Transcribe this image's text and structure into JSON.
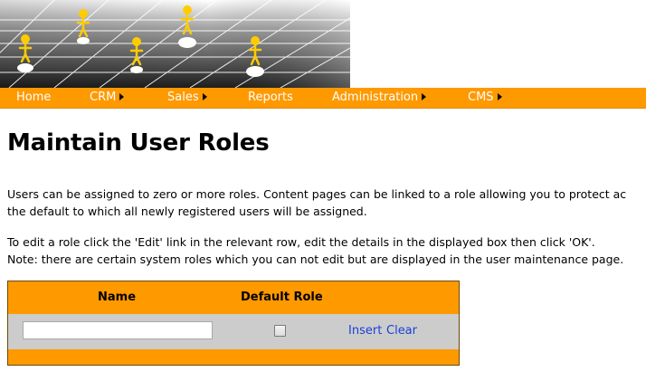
{
  "nav": {
    "items": [
      {
        "label": "Home",
        "has_submenu": false
      },
      {
        "label": "CRM",
        "has_submenu": true
      },
      {
        "label": "Sales",
        "has_submenu": true
      },
      {
        "label": "Reports",
        "has_submenu": false
      },
      {
        "label": "Administration",
        "has_submenu": true
      },
      {
        "label": "CMS",
        "has_submenu": true
      }
    ]
  },
  "page": {
    "title": "Maintain User Roles",
    "intro_line1": "Users can be assigned to zero or more roles. Content pages can be linked to a role allowing you to protect ac",
    "intro_line2": "the default to which all newly registered users will be assigned.",
    "edit_line1": "To edit a role click the 'Edit' link in the relevant row, edit the details in the displayed box then click 'OK'.",
    "edit_line2": "Note: there are certain system roles which you can not edit but are displayed in the user maintenance page."
  },
  "roles_table": {
    "headers": {
      "name": "Name",
      "default_role": "Default Role"
    },
    "new_row": {
      "name_value": "",
      "default_checked": false,
      "insert_label": "Insert",
      "clear_label": "Clear"
    }
  },
  "colors": {
    "accent": "#ff9900",
    "row_background": "#cccccc",
    "link": "#1a3fd6",
    "banner_figure": "#ffcc00"
  }
}
